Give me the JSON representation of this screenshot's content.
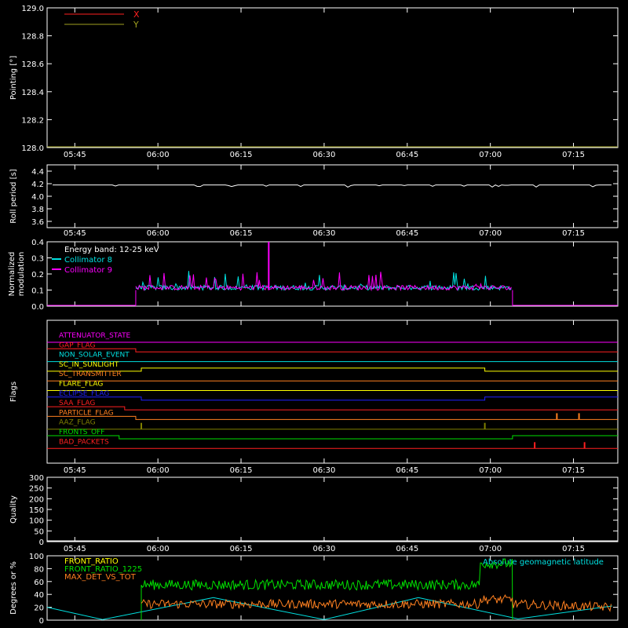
{
  "colors": {
    "background": "#000000",
    "axis": "#ffffff",
    "red": "#ff2020",
    "olive": "#a0a020",
    "white": "#ffffff",
    "cyan": "#00e0e0",
    "magenta": "#ff00ff",
    "blue": "#2020ff",
    "yellow": "#ffff00",
    "orange": "#ff8020",
    "green": "#00e000",
    "dark_olive": "#808000"
  },
  "time_axis": {
    "start": "05:40",
    "end": "07:23",
    "tick_labels": [
      "05:45",
      "06:00",
      "06:15",
      "06:30",
      "06:45",
      "07:00",
      "07:15"
    ]
  },
  "chart_data": [
    {
      "type": "line",
      "id": "pointing",
      "ylabel": "Pointing [°]",
      "ylim": [
        128.0,
        129.0
      ],
      "yticks": [
        "128.0",
        "128.2",
        "128.4",
        "128.6",
        "128.8",
        "129.0"
      ],
      "legend_position": "top-left",
      "series": [
        {
          "name": "X",
          "color": "#ff2020",
          "values": []
        },
        {
          "name": "Y",
          "color": "#a0a020",
          "values": []
        }
      ]
    },
    {
      "type": "line",
      "id": "roll_period",
      "ylabel": "Roll period [s]",
      "ylim": [
        3.5,
        4.5
      ],
      "yticks": [
        "3.6",
        "3.8",
        "4.0",
        "4.2",
        "4.4"
      ],
      "series": [
        {
          "color": "#ffffff",
          "x": [
            "05:41",
            "07:22"
          ],
          "values": [
            4.18,
            4.18
          ]
        }
      ]
    },
    {
      "type": "line",
      "id": "normalized_modulation",
      "ylabel": "Normalized modulation",
      "ylim": [
        0.0,
        0.4
      ],
      "yticks": [
        "0.0",
        "0.1",
        "0.2",
        "0.3",
        "0.4"
      ],
      "annotation": "Energy band: 12-25 keV",
      "legend_position": "top-left",
      "series": [
        {
          "name": "Collimator 8",
          "color": "#00e0e0",
          "x": [
            "05:56",
            "07:04"
          ],
          "values": [
            0.1,
            0.1
          ]
        },
        {
          "name": "Collimator 9",
          "color": "#ff00ff",
          "x": [
            "05:56",
            "07:04"
          ],
          "values": [
            0.1,
            0.1
          ],
          "peaks": [
            {
              "x": "06:20",
              "value": 0.4
            }
          ]
        }
      ]
    },
    {
      "type": "line",
      "id": "flags",
      "ylabel": "Flags",
      "series": [
        {
          "name": "ATTENUATOR_STATE",
          "color": "#ff00ff",
          "steps": [
            {
              "x": "05:40",
              "state": 0
            }
          ]
        },
        {
          "name": "GAP_FLAG",
          "color": "#ff2020",
          "steps": [
            {
              "x": "05:40",
              "state": 1
            },
            {
              "x": "05:56",
              "state": 0
            }
          ]
        },
        {
          "name": "NON_SOLAR_EVENT",
          "color": "#00e0e0",
          "steps": [
            {
              "x": "05:40",
              "state": 0
            }
          ]
        },
        {
          "name": "SC_IN_SUNLIGHT",
          "color": "#ffff00",
          "steps": [
            {
              "x": "05:40",
              "state": 0
            },
            {
              "x": "05:57",
              "state": 1
            },
            {
              "x": "06:59",
              "state": 0
            }
          ]
        },
        {
          "name": "SC_TRANSMITTER",
          "color": "#ff8020",
          "steps": [
            {
              "x": "05:40",
              "state": 0
            }
          ]
        },
        {
          "name": "FLARE_FLAG",
          "color": "#ffff00",
          "steps": [
            {
              "x": "05:40",
              "state": 0
            }
          ]
        },
        {
          "name": "ECLIPSE_FLAG",
          "color": "#2020ff",
          "steps": [
            {
              "x": "05:40",
              "state": 1
            },
            {
              "x": "05:57",
              "state": 0
            },
            {
              "x": "06:59",
              "state": 1
            }
          ]
        },
        {
          "name": "SAA_FLAG",
          "color": "#ff2020",
          "steps": [
            {
              "x": "05:40",
              "state": 1
            },
            {
              "x": "05:54",
              "state": 0
            }
          ]
        },
        {
          "name": "PARTICLE_FLAG",
          "color": "#ff8020",
          "steps": [
            {
              "x": "05:40",
              "state": 1
            },
            {
              "x": "05:56",
              "state": 0
            }
          ],
          "spikes": [
            "07:12",
            "07:16"
          ]
        },
        {
          "name": "AAZ_FLAG",
          "color": "#808000",
          "steps": [
            {
              "x": "05:40",
              "state": 0
            }
          ],
          "spikes": [
            "05:57",
            "06:59"
          ]
        },
        {
          "name": "FRONTS_OFF",
          "color": "#00e000",
          "steps": [
            {
              "x": "05:40",
              "state": 1
            },
            {
              "x": "05:53",
              "state": 0
            },
            {
              "x": "07:04",
              "state": 1
            }
          ]
        },
        {
          "name": "BAD_PACKETS",
          "color": "#ff2020",
          "steps": [
            {
              "x": "05:40",
              "state": 0
            }
          ],
          "spikes": [
            "07:08",
            "07:17"
          ]
        }
      ]
    },
    {
      "type": "line",
      "id": "quality",
      "ylabel": "Quality",
      "ylim": [
        0,
        300
      ],
      "yticks": [
        "0",
        "50",
        "100",
        "150",
        "200",
        "250",
        "300"
      ],
      "series": [
        {
          "color": "#ffffff",
          "values": []
        }
      ]
    },
    {
      "type": "line",
      "id": "degrees_percent",
      "ylabel": "Degrees or %",
      "ylim": [
        0,
        100
      ],
      "yticks": [
        "0",
        "20",
        "40",
        "60",
        "80",
        "100"
      ],
      "legend_position": "top-left",
      "series": [
        {
          "name": "FRONT_RATIO",
          "color": "#ffff00",
          "values": []
        },
        {
          "name": "FRONT_RATIO_1225",
          "color": "#00e000",
          "x": [
            "05:57",
            "06:30",
            "06:57",
            "06:58",
            "07:04"
          ],
          "values": [
            55,
            55,
            58,
            88,
            88
          ]
        },
        {
          "name": "MAX_DET_VS_TOT",
          "color": "#ff8020",
          "x": [
            "05:57",
            "06:30",
            "06:58",
            "07:04",
            "07:22"
          ],
          "values": [
            25,
            25,
            25,
            32,
            22
          ]
        },
        {
          "name": "Absolute geomagnetic latitude",
          "color": "#00e0e0",
          "x": [
            "05:40",
            "05:50",
            "06:10",
            "06:30",
            "06:47",
            "07:05",
            "07:22"
          ],
          "values": [
            20,
            1,
            35,
            1,
            35,
            2,
            22
          ]
        }
      ]
    }
  ]
}
